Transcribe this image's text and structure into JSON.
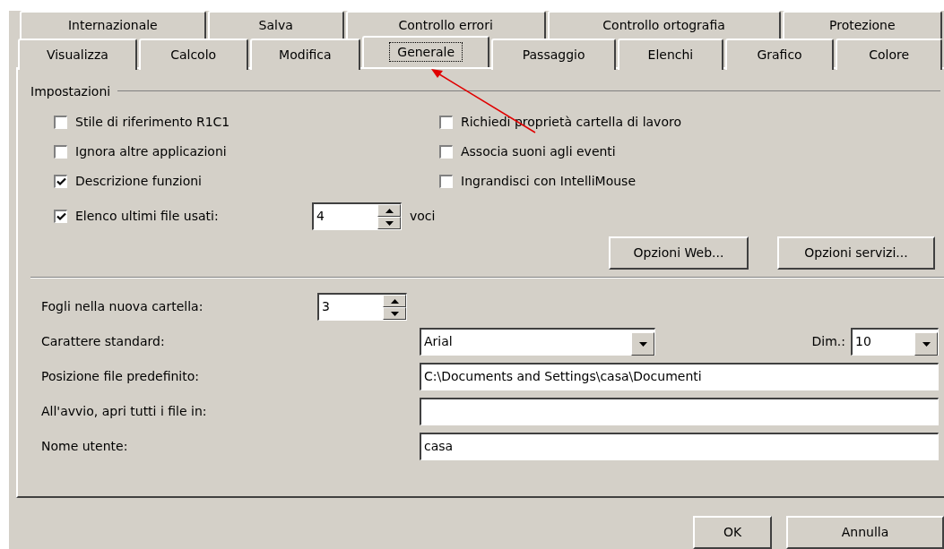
{
  "tab_rows": [
    [
      {
        "label": "Internazionale",
        "selected": false
      },
      {
        "label": "Salva",
        "selected": false
      },
      {
        "label": "Controllo errori",
        "selected": false
      },
      {
        "label": "Controllo ortografia",
        "selected": false
      },
      {
        "label": "Protezione",
        "selected": false
      }
    ],
    [
      {
        "label": "Visualizza",
        "selected": false
      },
      {
        "label": "Calcolo",
        "selected": false
      },
      {
        "label": "Modifica",
        "selected": false
      },
      {
        "label": "Generale",
        "selected": true
      },
      {
        "label": "Passaggio",
        "selected": false
      },
      {
        "label": "Elenchi",
        "selected": false
      },
      {
        "label": "Grafico",
        "selected": false
      },
      {
        "label": "Colore",
        "selected": false
      }
    ]
  ],
  "settings": {
    "title": "Impostazioni",
    "left": [
      {
        "kind": "checkbox",
        "label": "Stile di riferimento R1C1",
        "checked": false
      },
      {
        "kind": "checkbox",
        "label": "Ignora altre applicazioni",
        "checked": false
      },
      {
        "kind": "checkbox",
        "label": "Descrizione funzioni",
        "checked": true
      },
      {
        "kind": "checkbox_spin",
        "label": "Elenco ultimi file usati:",
        "checked": true,
        "value": "4",
        "unit": "voci"
      }
    ],
    "right": [
      {
        "kind": "checkbox",
        "label": "Richiedi proprietà cartella di lavoro",
        "checked": false
      },
      {
        "kind": "checkbox",
        "label": "Associa suoni agli eventi",
        "checked": false
      },
      {
        "kind": "checkbox",
        "label": "Ingrandisci con IntelliMouse",
        "checked": false
      }
    ],
    "buttons": [
      "Opzioni Web...",
      "Opzioni servizi..."
    ]
  },
  "fields": [
    {
      "kind": "spin",
      "label": "Fogli nella nuova cartella:",
      "value": "3"
    },
    {
      "kind": "select",
      "label": "Carattere standard:",
      "value": "Arial",
      "size_label": "Dim.:",
      "size_value": "10"
    },
    {
      "kind": "text",
      "label": "Posizione file predefinito:",
      "value": "C:\\Documents and Settings\\casa\\Documenti"
    },
    {
      "kind": "text",
      "label": "All'avvio, apri tutti i file in:"
    },
    {
      "kind": "text",
      "label": "Nome utente:",
      "value": "casa"
    }
  ],
  "footer_buttons": [
    "OK",
    "Annulla"
  ]
}
